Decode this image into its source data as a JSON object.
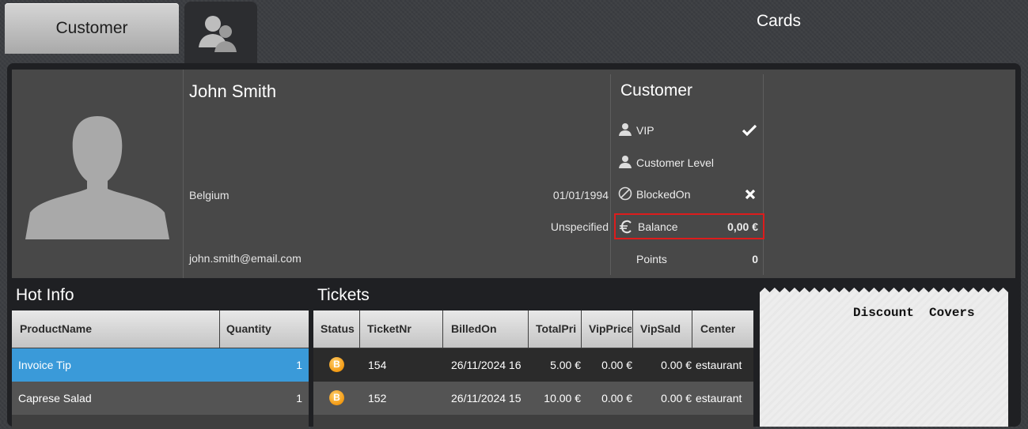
{
  "tabs": {
    "customer_label": "Customer",
    "profile_icon": "user-group-icon"
  },
  "profile": {
    "photo_icon": "person-silhouette-icon",
    "name": "John Smith",
    "country": "Belgium",
    "birth_date": "01/01/1994",
    "gender": "Unspecified",
    "email": "john.smith@email.com"
  },
  "customer": {
    "title": "Customer",
    "vip_label": "VIP",
    "vip_value_icon": "checkmark-icon",
    "level_label": "Customer Level",
    "blocked_label": "BlockedOn",
    "blocked_value_icon": "cross-icon",
    "balance_label": "Balance",
    "balance_value": "0,00 €",
    "points_label": "Points",
    "points_value": "0"
  },
  "cards": {
    "title": "Cards"
  },
  "hot_info": {
    "title": "Hot Info",
    "headers": {
      "product": "ProductName",
      "quantity": "Quantity"
    },
    "rows": [
      {
        "product": "Invoice Tip",
        "quantity": "1",
        "selected": true
      },
      {
        "product": "Caprese Salad",
        "quantity": "1",
        "selected": false
      }
    ]
  },
  "tickets": {
    "title": "Tickets",
    "headers": {
      "status": "Status",
      "ticket_nr": "TicketNr",
      "billed_on": "BilledOn",
      "total": "TotalPri",
      "vip_price": "VipPrice",
      "vip_sald": "VipSald",
      "center": "Center"
    },
    "rows": [
      {
        "status": "B",
        "ticket_nr": "154",
        "billed_on": "26/11/2024 16",
        "total": "5.00 €",
        "vip_price": "0.00 €",
        "vip_sald": "0.00 €",
        "center": "estaurant"
      },
      {
        "status": "B",
        "ticket_nr": "152",
        "billed_on": "26/11/2024 15",
        "total": "10.00 €",
        "vip_price": "0.00 €",
        "vip_sald": "0.00 €",
        "center": "estaurant"
      }
    ]
  },
  "receipt": {
    "text": "Discount  Covers"
  },
  "colors": {
    "selected_row": "#3a9ad9",
    "highlight_border": "#dd1c1c",
    "badge": "#f39a12"
  }
}
